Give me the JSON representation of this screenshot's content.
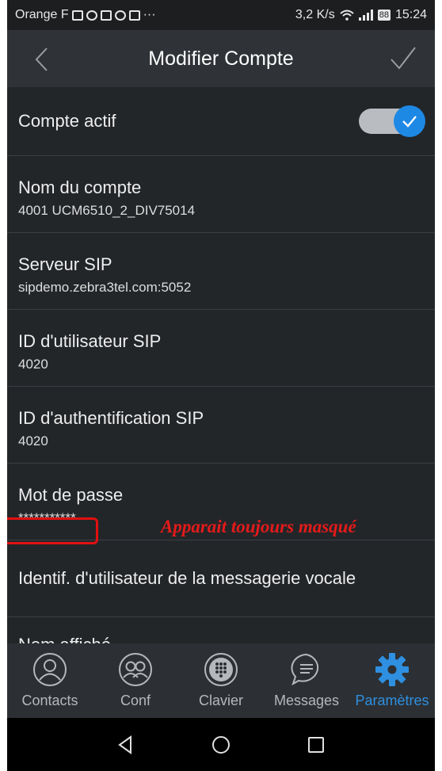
{
  "status_bar": {
    "carrier": "Orange F",
    "more": "···",
    "speed": "3,2 K/s",
    "battery": "88",
    "time": "15:24"
  },
  "app_bar": {
    "title": "Modifier Compte",
    "back_icon": "chevron-left-icon",
    "confirm_icon": "checkmark-icon"
  },
  "account": {
    "active_label": "Compte actif",
    "active": true,
    "name_label": "Nom du compte",
    "name_value": "4001 UCM6510_2_DIV75014",
    "server_label": "Serveur SIP",
    "server_value": "sipdemo.zebra3tel.com:5052",
    "user_id_label": "ID d'utilisateur SIP",
    "user_id_value": "4020",
    "auth_id_label": "ID d'authentification SIP",
    "auth_id_value": "4020",
    "password_label": "Mot de passe",
    "password_value": "***********",
    "voicemail_label": "Identif. d'utilisateur de la messagerie vocale",
    "display_name_label": "Nom affiché"
  },
  "annotation": {
    "text": "Apparait toujours masqué",
    "color": "#e51a1a"
  },
  "bottom_nav": {
    "items": [
      {
        "label": "Contacts",
        "icon": "person-icon"
      },
      {
        "label": "Conf",
        "icon": "group-icon"
      },
      {
        "label": "Clavier",
        "icon": "dialpad-icon"
      },
      {
        "label": "Messages",
        "icon": "chat-icon"
      },
      {
        "label": "Paramètres",
        "icon": "gear-icon"
      }
    ],
    "active_index": 4,
    "accent": "#2f8fe0"
  }
}
